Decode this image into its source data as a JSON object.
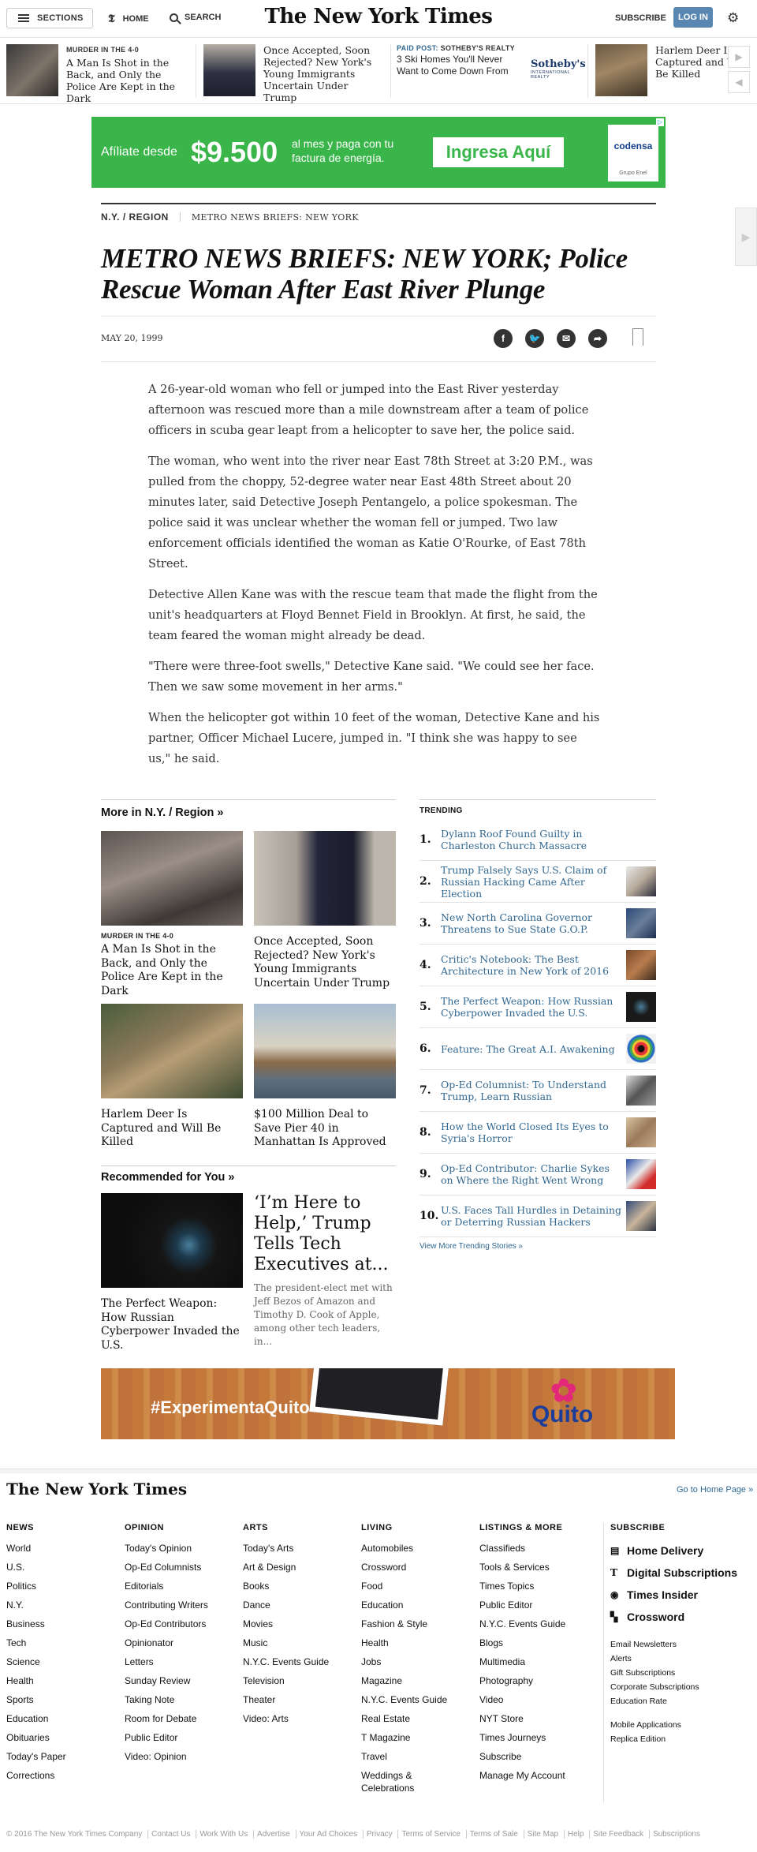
{
  "masthead": {
    "sections_label": "SECTIONS",
    "home_label": "HOME",
    "search_label": "SEARCH",
    "logo_text": "The New York Times",
    "subscribe_label": "SUBSCRIBE",
    "login_label": "LOG IN"
  },
  "ribbon": {
    "items": [
      {
        "kicker": "MURDER IN THE 4-0",
        "title": "A Man Is Shot in the Back, and Only the Police Are Kept in the Dark"
      },
      {
        "kicker": "",
        "title": "Once Accepted, Soon Rejected? New York's Young Immigrants Uncertain Under Trump"
      },
      {
        "kicker": "",
        "title": "Harlem Deer Is Captured and Will Be Killed"
      }
    ],
    "paid_post": {
      "label": "PAID POST:",
      "sponsor": "SOTHEBY'S REALTY",
      "title": "3 Ski Homes You'll Never Want to Come Down From",
      "logo": "Sotheby's",
      "logo_sub": "INTERNATIONAL REALTY"
    }
  },
  "top_ad": {
    "lead": "Afíliate desde",
    "price": "$9.500",
    "text": "al mes y paga con tu factura de energía.",
    "cta": "Ingresa Aquí",
    "brand": "codensa",
    "brand_sub": "Grupo Enel"
  },
  "article": {
    "section": "N.Y. / REGION",
    "slug": "METRO NEWS BRIEFS: NEW YORK",
    "headline": "METRO NEWS BRIEFS: NEW YORK; Police Rescue Woman After East River Plunge",
    "date": "MAY 20, 1999",
    "paragraphs": [
      "A 26-year-old woman who fell or jumped into the East River yesterday afternoon was rescued more than a mile downstream after a team of police officers in scuba gear leapt from a helicopter to save her, the police said.",
      "The woman, who went into the river near East 78th Street at 3:20 P.M., was pulled from the choppy, 52-degree water near East 48th Street about 20 minutes later, said Detective Joseph Pentangelo, a police spokesman. The police said it was unclear whether the woman fell or jumped. Two law enforcement officials identified the woman as Katie O'Rourke, of East 78th Street.",
      "Detective Allen Kane was with the rescue team that made the flight from the unit's headquarters at Floyd Bennet Field in Brooklyn. At first, he said, the team feared the woman might already be dead.",
      "\"There were three-foot swells,\" Detective Kane said. \"We could see her face. Then we saw some movement in her arms.\"",
      "When the helicopter got within 10 feet of the woman, Detective Kane and his partner, Officer Michael Lucere, jumped in. \"I think she was happy to see us,\" he said."
    ]
  },
  "more_in": {
    "heading": "More in N.Y. / Region »",
    "cards": [
      {
        "kicker": "MURDER IN THE 4-0",
        "title": "A Man Is Shot in the Back, and Only the Police Are Kept in the Dark"
      },
      {
        "kicker": "",
        "title": "Once Accepted, Soon Rejected? New York's Young Immigrants Uncertain Under Trump"
      },
      {
        "kicker": "",
        "title": "Harlem Deer Is Captured and Will Be Killed"
      },
      {
        "kicker": "",
        "title": "$100 Million Deal to Save Pier 40 in Manhattan Is Approved"
      }
    ]
  },
  "recommended": {
    "heading": "Recommended for You »",
    "card_title": "The Perfect Weapon: How Russian Cyberpower Invaded the U.S.",
    "big_title": "‘I’m Here to Help,’ Trump Tells Tech Executives at...",
    "big_summary": "The president-elect met with Jeff Bezos of Amazon and Timothy D. Cook of Apple, among other tech leaders, in..."
  },
  "trending": {
    "label": "TRENDING",
    "items": [
      {
        "num": "1.",
        "title": "Dylann Roof Found Guilty in Charleston Church Massacre"
      },
      {
        "num": "2.",
        "title": "Trump Falsely Says U.S. Claim of Russian Hacking Came After Election"
      },
      {
        "num": "3.",
        "title": "New North Carolina Governor Threatens to Sue State G.O.P."
      },
      {
        "num": "4.",
        "title": "Critic's Notebook: The Best Architecture in New York of 2016"
      },
      {
        "num": "5.",
        "title": "The Perfect Weapon: How Russian Cyberpower Invaded the U.S."
      },
      {
        "num": "6.",
        "title": "Feature: The Great A.I. Awakening"
      },
      {
        "num": "7.",
        "title": "Op-Ed Columnist: To Understand Trump, Learn Russian"
      },
      {
        "num": "8.",
        "title": "How the World Closed Its Eyes to Syria's Horror"
      },
      {
        "num": "9.",
        "title": "Op-Ed Contributor: Charlie Sykes on Where the Right Went Wrong"
      },
      {
        "num": "10.",
        "title": "U.S. Faces Tall Hurdles in Detaining or Deterring Russian Hackers"
      }
    ],
    "more": "View More Trending Stories »"
  },
  "bottom_ad": {
    "tag": "#ExperimentaQuito",
    "logo": "Quito"
  },
  "footer": {
    "logo": "The New York Times",
    "home_link": "Go to Home Page »",
    "columns": [
      {
        "heading": "NEWS",
        "items": [
          "World",
          "U.S.",
          "Politics",
          "N.Y.",
          "Business",
          "Tech",
          "Science",
          "Health",
          "Sports",
          "Education",
          "Obituaries",
          "Today's Paper",
          "Corrections"
        ]
      },
      {
        "heading": "OPINION",
        "items": [
          "Today's Opinion",
          "Op-Ed Columnists",
          "Editorials",
          "Contributing Writers",
          "Op-Ed Contributors",
          "Opinionator",
          "Letters",
          "Sunday Review",
          "Taking Note",
          "Room for Debate",
          "Public Editor",
          "Video: Opinion"
        ]
      },
      {
        "heading": "ARTS",
        "items": [
          "Today's Arts",
          "Art & Design",
          "Books",
          "Dance",
          "Movies",
          "Music",
          "N.Y.C. Events Guide",
          "Television",
          "Theater",
          "Video: Arts"
        ]
      },
      {
        "heading": "LIVING",
        "items": [
          "Automobiles",
          "Crossword",
          "Food",
          "Education",
          "Fashion & Style",
          "Health",
          "Jobs",
          "Magazine",
          "N.Y.C. Events Guide",
          "Real Estate",
          "T Magazine",
          "Travel",
          "Weddings & Celebrations"
        ]
      },
      {
        "heading": "LISTINGS & MORE",
        "items": [
          "Classifieds",
          "Tools & Services",
          "Times Topics",
          "Public Editor",
          "N.Y.C. Events Guide",
          "Blogs",
          "Multimedia",
          "Photography",
          "Video",
          "NYT Store",
          "Times Journeys",
          "Subscribe",
          "Manage My Account"
        ]
      }
    ],
    "subscribe": {
      "heading": "SUBSCRIBE",
      "big": [
        "Home Delivery",
        "Digital Subscriptions",
        "Times Insider",
        "Crossword"
      ],
      "small1": [
        "Email Newsletters",
        "Alerts",
        "Gift Subscriptions",
        "Corporate Subscriptions",
        "Education Rate"
      ],
      "small2": [
        "Mobile Applications",
        "Replica Edition"
      ]
    },
    "bottom_links": [
      "© 2016 The New York Times Company",
      "Contact Us",
      "Work With Us",
      "Advertise",
      "Your Ad Choices",
      "Privacy",
      "Terms of Service",
      "Terms of Sale",
      "Site Map",
      "Help",
      "Site Feedback",
      "Subscriptions"
    ]
  }
}
